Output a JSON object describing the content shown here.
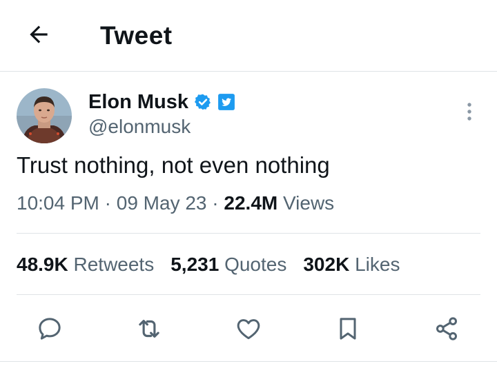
{
  "header": {
    "title": "Tweet",
    "back_icon": "arrow-left-icon"
  },
  "tweet": {
    "author": {
      "name": "Elon Musk",
      "handle": "@elonmusk",
      "verified_icon": "verified-badge-icon",
      "affiliation_icon": "twitter-bird-icon"
    },
    "text": "Trust nothing, not even nothing",
    "meta": {
      "time": "10:04 PM",
      "sep1": " · ",
      "date": "09 May 23",
      "sep2": " · ",
      "views_count": "22.4M",
      "views_label": " Views"
    },
    "stats": {
      "retweets_count": "48.9K",
      "retweets_label": " Retweets",
      "quotes_count": "5,231",
      "quotes_label": " Quotes",
      "likes_count": "302K",
      "likes_label": " Likes"
    },
    "actions": [
      "reply-icon",
      "retweet-icon",
      "like-icon",
      "bookmark-icon",
      "share-icon"
    ]
  },
  "colors": {
    "text": "#0f1419",
    "secondary": "#536471",
    "divider": "#dfe3e6",
    "verified": "#1d9bf0"
  }
}
